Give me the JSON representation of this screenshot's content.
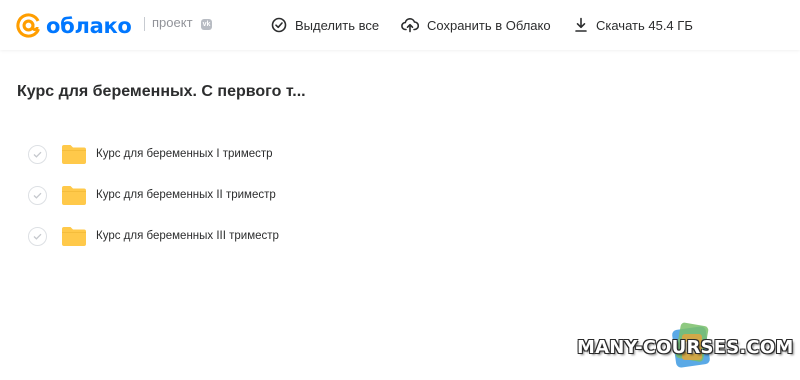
{
  "header": {
    "logo_text": "облако",
    "project_label": "проект",
    "vk_badge": "vk",
    "actions": [
      {
        "label": "Выделить все",
        "icon": "check-circle-icon"
      },
      {
        "label": "Сохранить в Облако",
        "icon": "cloud-upload-icon"
      },
      {
        "label": "Скачать 45.4 ГБ",
        "icon": "download-icon"
      }
    ]
  },
  "main": {
    "title": "Курс для беременных. С первого т...",
    "items": [
      {
        "label": "Курс для беременных I триместр",
        "icon": "folder-icon"
      },
      {
        "label": "Курс для беременных II триместр",
        "icon": "folder-icon"
      },
      {
        "label": "Курс для беременных III триместр",
        "icon": "folder-icon"
      }
    ]
  },
  "watermark": {
    "text": "MANY-COURSES.COM"
  },
  "colors": {
    "brand": "#0077ff",
    "logo_at": "#ff9e00",
    "folder": "#ffc94a",
    "text": "#2c2d2e",
    "muted": "#919399"
  }
}
